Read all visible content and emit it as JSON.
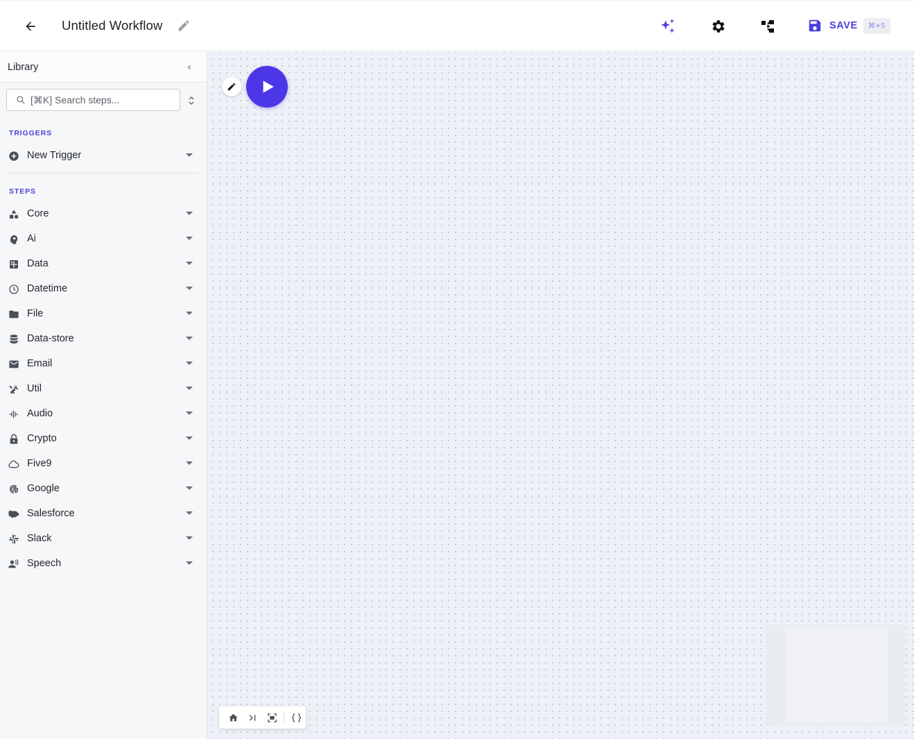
{
  "header": {
    "title": "Untitled Workflow",
    "save_label": "SAVE",
    "save_shortcut": "⌘+S",
    "accent_color": "#4b3fdc"
  },
  "sidebar": {
    "title": "Library",
    "search_placeholder": "[⌘K] Search steps...",
    "triggers_label": "TRIGGERS",
    "trigger_item": {
      "label": "New Trigger",
      "icon": "plus-circle-icon"
    },
    "steps_label": "STEPS",
    "steps": [
      {
        "label": "Core",
        "icon": "shapes-icon"
      },
      {
        "label": "Ai",
        "icon": "brain-icon"
      },
      {
        "label": "Data",
        "icon": "grid-icon"
      },
      {
        "label": "Datetime",
        "icon": "clock-icon"
      },
      {
        "label": "File",
        "icon": "folder-icon"
      },
      {
        "label": "Data-store",
        "icon": "database-icon"
      },
      {
        "label": "Email",
        "icon": "envelope-icon"
      },
      {
        "label": "Util",
        "icon": "tools-icon"
      },
      {
        "label": "Audio",
        "icon": "waveform-icon"
      },
      {
        "label": "Crypto",
        "icon": "lock-icon"
      },
      {
        "label": "Five9",
        "icon": "cloud-icon"
      },
      {
        "label": "Google",
        "icon": "google-icon"
      },
      {
        "label": "Salesforce",
        "icon": "salesforce-cloud-icon"
      },
      {
        "label": "Slack",
        "icon": "slack-icon"
      },
      {
        "label": "Speech",
        "icon": "speaker-person-icon"
      }
    ]
  },
  "canvas": {
    "run_node_color": "#4b37e8",
    "controls": [
      "home-icon",
      "step-forward-icon",
      "fit-view-icon",
      "code-braces-icon"
    ]
  }
}
